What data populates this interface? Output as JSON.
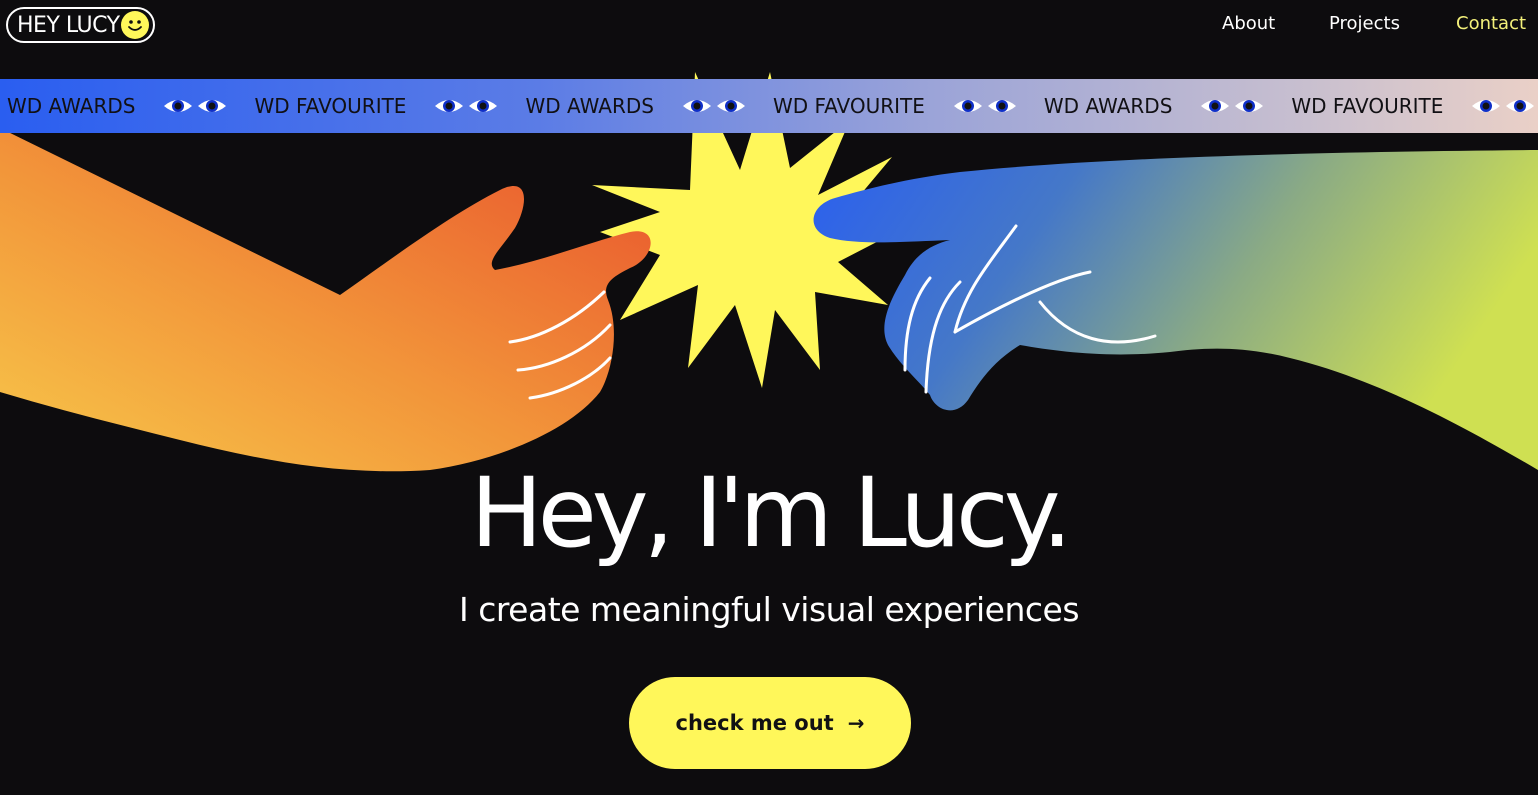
{
  "header": {
    "logo_text": "HEY LUCY",
    "logo_icon": "smiley-face-icon",
    "nav": [
      {
        "label": "About"
      },
      {
        "label": "Projects"
      },
      {
        "label": "Contact",
        "active": true
      }
    ]
  },
  "marquee": {
    "items": [
      "WD AWARDS",
      "WD FAVOURITE",
      "WD AWARDS",
      "WD FAVOURITE",
      "WD AWARDS",
      "WD FAVOURITE"
    ],
    "separator_icon": "eyes-icon"
  },
  "hero": {
    "title": "Hey, I'm Lucy.",
    "subtitle": "I create meaningful visual experiences",
    "cta_label": "check me out",
    "cta_arrow": "→"
  },
  "colors": {
    "background": "#0d0c0e",
    "accent_yellow": "#fff75a",
    "contact_link": "#f3f07a",
    "orange_hand": "#f08a2e",
    "blue_hand": "#2f5fe0",
    "lime_arm": "#c8e05a"
  }
}
